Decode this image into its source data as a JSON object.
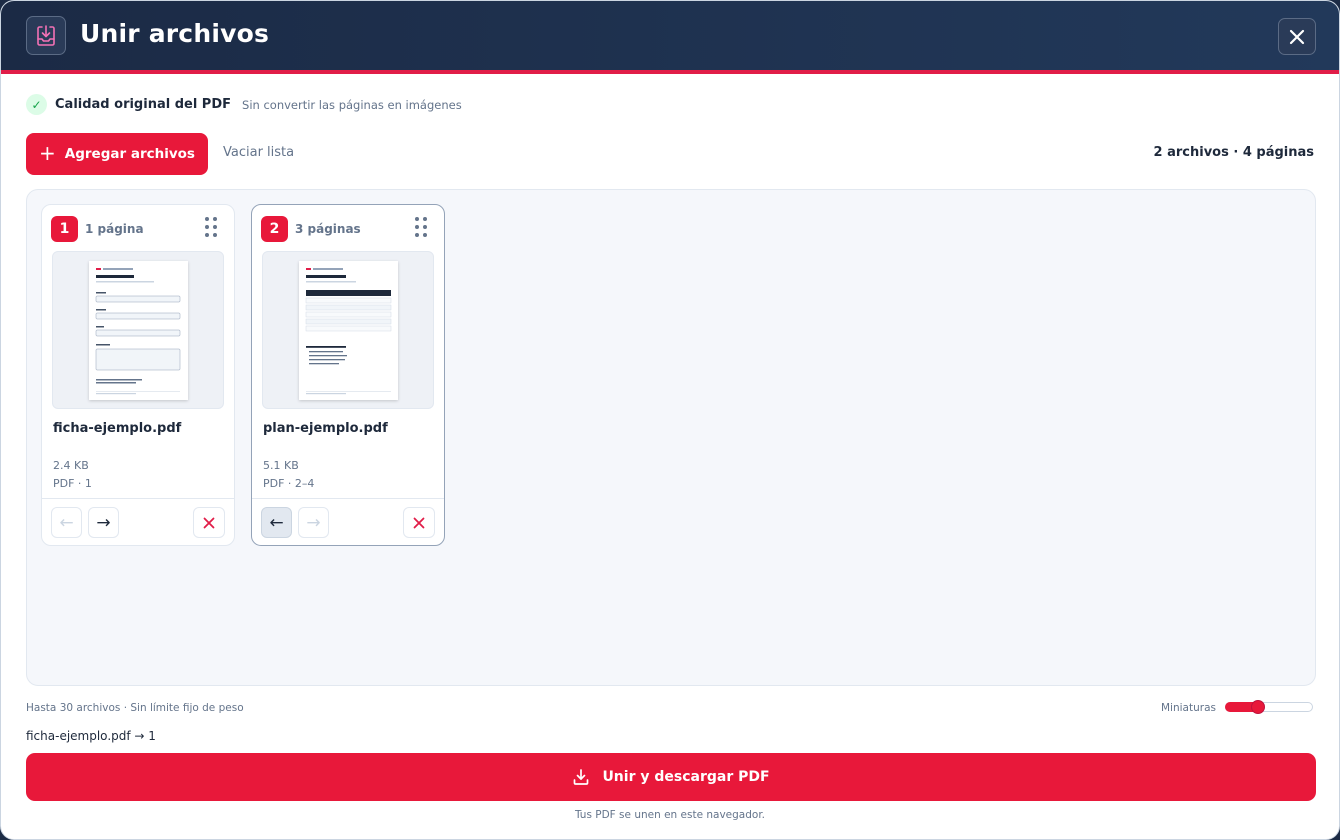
{
  "header": {
    "title": "Unir archivos",
    "app_icon": "merge-download-icon",
    "close_icon": "close-icon"
  },
  "quality": {
    "label": "Calidad original del PDF",
    "note": "Sin convertir las páginas en imágenes",
    "icon": "check-icon"
  },
  "toolbar": {
    "add_symbol": "+",
    "add_label": "Agregar archivos",
    "clear_label": "Vaciar lista",
    "summary": "2 archivos · 4 páginas"
  },
  "files": [
    {
      "index": "1",
      "pages_label": "1 página",
      "name": "ficha-ejemplo.pdf",
      "size": "2.4 KB",
      "range": "PDF · 1",
      "prev_arrow": "←",
      "next_arrow": "→"
    },
    {
      "index": "2",
      "pages_label": "3 páginas",
      "name": "plan-ejemplo.pdf",
      "size": "5.1 KB",
      "range": "PDF · 2–4",
      "prev_arrow": "←",
      "next_arrow": "→"
    }
  ],
  "footer": {
    "limits": "Hasta 30 archivos · Sin límite fijo de peso",
    "thumbnails_label": "Miniaturas",
    "thumbnail_zoom_fraction": 0.37,
    "order_preview": "ficha-ejemplo.pdf → 1",
    "merge_label": "Unir y descargar PDF",
    "privacy_note": "Tus PDF se unen en este navegador."
  },
  "colors": {
    "accent": "#e8183a",
    "header_bg": "#1b2a45",
    "success": "#16a34a"
  }
}
